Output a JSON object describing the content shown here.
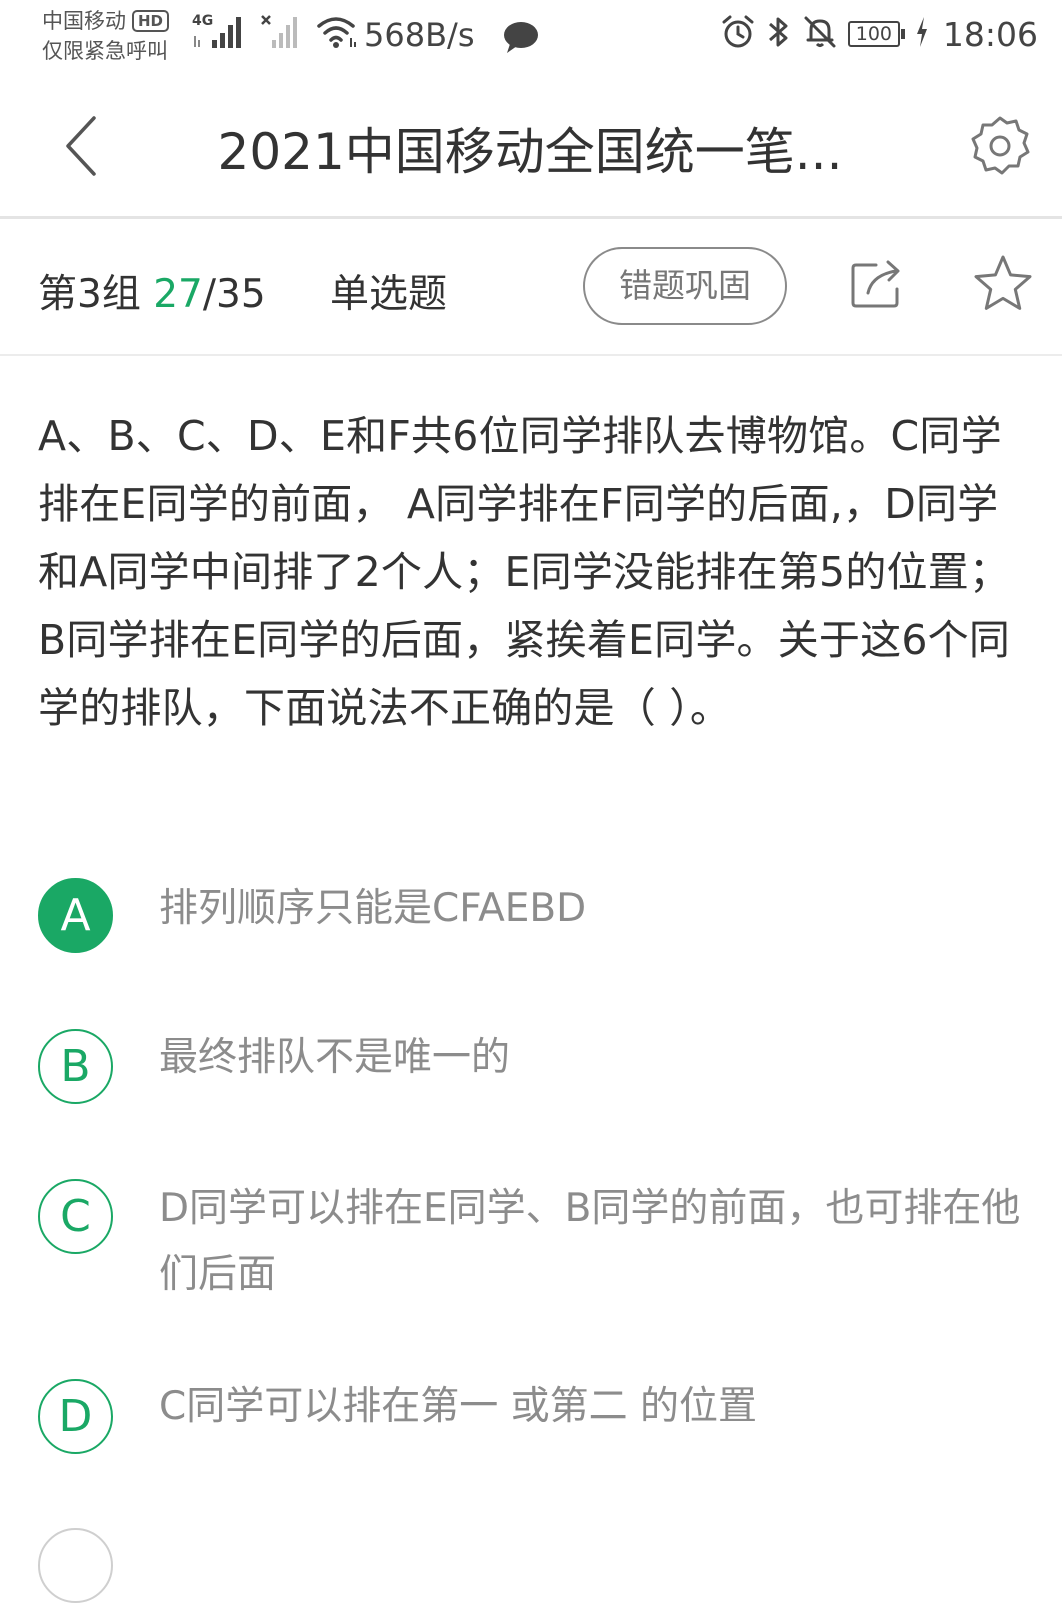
{
  "status_bar": {
    "carrier_name": "中国移动",
    "hd_badge": "HD",
    "emergency_text": "仅限紧急呼叫",
    "network_type": "4G",
    "net_speed": "568B/s",
    "battery_level": "100",
    "time": "18:06",
    "icons": [
      "signal-icon",
      "no-signal-icon",
      "wifi-icon",
      "chat-icon",
      "alarm-icon",
      "bluetooth-icon",
      "mute-icon",
      "battery-icon",
      "charging-icon"
    ]
  },
  "header": {
    "title": "2021中国移动全国统一笔...",
    "icons": [
      "back-icon",
      "settings-icon"
    ]
  },
  "info_bar": {
    "group_label": "第3组",
    "progress_current": "27",
    "progress_total": "/35",
    "question_type": "单选题",
    "review_button_label": "错题巩固",
    "icons": [
      "share-icon",
      "star-icon"
    ]
  },
  "question": {
    "text": "A、B、C、D、E和F共6位同学排队去博物馆。C同学排在E同学的前面， A同学排在F同学的后面,，D同学和A同学中间排了2个人；E同学没能排在第5的位置； B同学排在E同学的后面，紧挨着E同学。关于这6个同学的排队，下面说法不正确的是（ ）。"
  },
  "options": [
    {
      "letter": "A",
      "text": "排列顺序只能是CFAEBD",
      "selected": true
    },
    {
      "letter": "B",
      "text": "最终排队不是唯一的",
      "selected": false
    },
    {
      "letter": "C",
      "text": "D同学可以排在E同学、B同学的前面，也可排在他们后面",
      "selected": false
    },
    {
      "letter": "D",
      "text": "C同学可以排在第一 或第二 的位置",
      "selected": false
    }
  ],
  "colors": {
    "accent_green": "#1aa865",
    "text_primary": "#333333",
    "text_option": "#8c8c8c",
    "divider": "#e4e4e4"
  }
}
